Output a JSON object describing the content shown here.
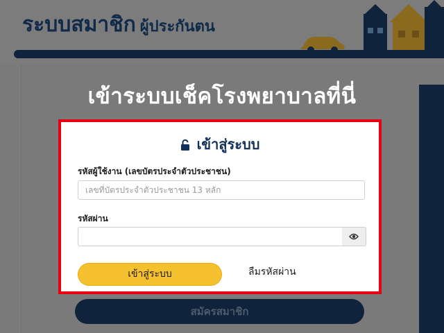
{
  "background": {
    "site_title": "ระบบสมาชิก",
    "site_subtitle": "ผู้ประกันตน",
    "register_label": "สมัครสมาชิก"
  },
  "headline": "เข้าระบบเช็คโรงพยาบาลที่นี่",
  "login": {
    "title": "เข้าสู่ระบบ",
    "title_icon": "unlock-icon",
    "username_label": "รหัสผู้ใช้งาน (เลขบัตรประจำตัวประชาชน)",
    "username_placeholder": "เลขที่บัตรประจำตัวประชาชน 13 หลัก",
    "username_value": "",
    "password_label": "รหัสผ่าน",
    "password_value": "",
    "password_toggle_icon": "eye-icon",
    "submit_label": "เข้าสู่ระบบ",
    "forgot_label": "ลืมรหัสผ่าน"
  },
  "colors": {
    "highlight_border": "#e60012",
    "navy": "#12305a",
    "button_yellow": "#f5c12e"
  }
}
